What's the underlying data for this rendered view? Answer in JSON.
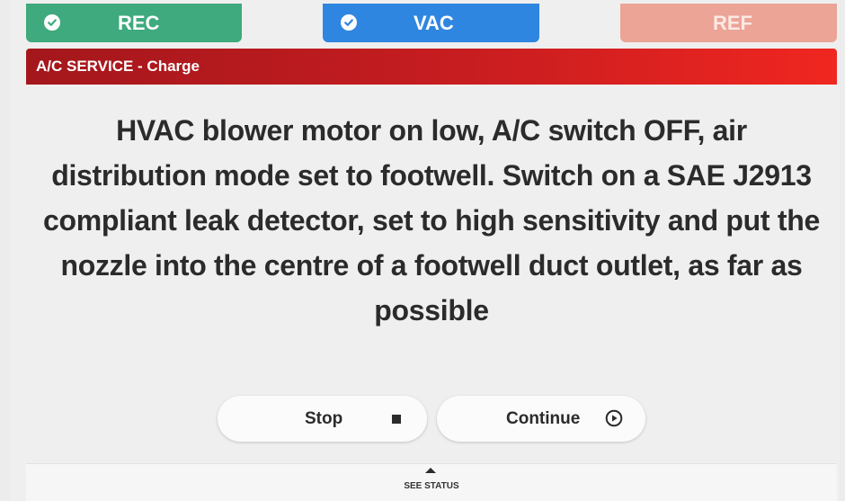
{
  "tabs": [
    {
      "label": "REC",
      "checked": true,
      "color": "#3faa7d"
    },
    {
      "label": "VAC",
      "checked": true,
      "color": "#2f86e0"
    },
    {
      "label": "REF",
      "checked": false,
      "color": "#eba496"
    }
  ],
  "header": {
    "title": "A/C SERVICE - Charge",
    "color": "#c81d20"
  },
  "instruction": {
    "text": "HVAC blower motor on low, A/C switch OFF, air distribution mode set to footwell. Switch on a SAE J2913 compliant leak detector, set to high sensitivity and put the nozzle into the centre of a footwell duct outlet, as far as possible"
  },
  "buttons": {
    "stop": {
      "label": "Stop",
      "icon": "stop-square-icon"
    },
    "continue": {
      "label": "Continue",
      "icon": "play-circle-icon"
    }
  },
  "status_bar": {
    "label": "SEE STATUS",
    "icon": "caret-up-icon"
  }
}
